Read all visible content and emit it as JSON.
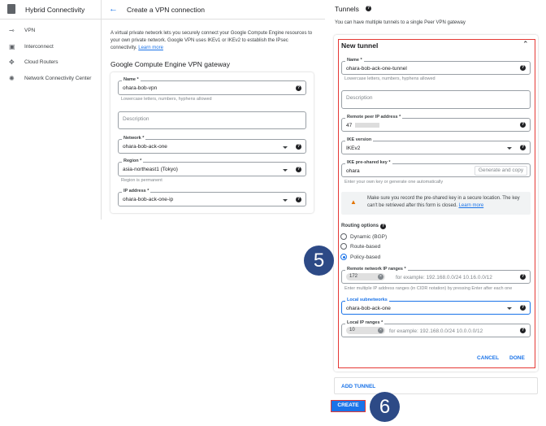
{
  "sidebar": {
    "title": "Hybrid Connectivity",
    "items": [
      {
        "label": "VPN",
        "icon": "vpn-icon"
      },
      {
        "label": "Interconnect",
        "icon": "interconnect-icon"
      },
      {
        "label": "Cloud Routers",
        "icon": "router-icon"
      },
      {
        "label": "Network Connectivity Center",
        "icon": "hub-icon"
      }
    ]
  },
  "header": {
    "title": "Create a VPN connection"
  },
  "intro": {
    "text": "A virtual private network lets you securely connect your Google Compute Engine resources to your own private network. Google VPN uses IKEv1 or IKEv2 to establish the IPsec connectivity.",
    "link": "Learn more"
  },
  "gateway": {
    "heading": "Google Compute Engine VPN gateway",
    "name": {
      "label": "Name *",
      "value": "ohara-bob-vpn",
      "hint": "Lowercase letters, numbers, hyphens allowed"
    },
    "description": {
      "placeholder": "Description"
    },
    "network": {
      "label": "Network *",
      "value": "ohara-bob-ack-one"
    },
    "region": {
      "label": "Region *",
      "value": "asia-northeast1 (Tokyo)",
      "hint": "Region is permanent"
    },
    "ip": {
      "label": "IP address *",
      "value": "ohara-bob-ack-one-ip"
    }
  },
  "tunnels": {
    "heading": "Tunnels",
    "subtext": "You can have multiple tunnels to a single Peer VPN gateway",
    "new_tunnel": {
      "title": "New tunnel",
      "name": {
        "label": "Name *",
        "value": "ohara-bob-ack-one-tunnel",
        "hint": "Lowercase letters, numbers, hyphens allowed"
      },
      "description": {
        "placeholder": "Description"
      },
      "peer_ip": {
        "label": "Remote peer IP address *",
        "value": "47"
      },
      "ike": {
        "label": "IKE version",
        "value": "IKEv2"
      },
      "psk": {
        "label": "IKE pre-shared key *",
        "value": "ohara",
        "button": "Generate and copy",
        "hint": "Enter your own key or generate one automatically"
      },
      "warning": {
        "text": "Make sure you record the pre-shared key in a secure location. The key can't be retrieved after this form is closed.",
        "link": "Learn more"
      },
      "routing": {
        "label": "Routing options",
        "options": [
          "Dynamic (BGP)",
          "Route-based",
          "Policy-based"
        ],
        "selected": "Policy-based"
      },
      "remote_ranges": {
        "label": "Remote network IP ranges *",
        "chip": "172",
        "placeholder": "for example: 192.168.0.0/24 10.16.0.0/12",
        "hint": "Enter multiple IP address ranges (in CIDR notation) by pressing Enter after each one"
      },
      "local_subnets": {
        "label": "Local subnetworks",
        "value": "ohara-bob-ack-one"
      },
      "local_ranges": {
        "label": "Local IP ranges *",
        "chip": "10",
        "placeholder": "for example: 192.168.0.0/24 10.0.0.0/12"
      },
      "cancel": "CANCEL",
      "done": "DONE"
    },
    "add": "ADD TUNNEL"
  },
  "create": "CREATE",
  "steps": [
    "5",
    "6"
  ],
  "colors": {
    "accent": "#1a73e8",
    "highlight": "#e53935",
    "step": "#2d4a86"
  }
}
